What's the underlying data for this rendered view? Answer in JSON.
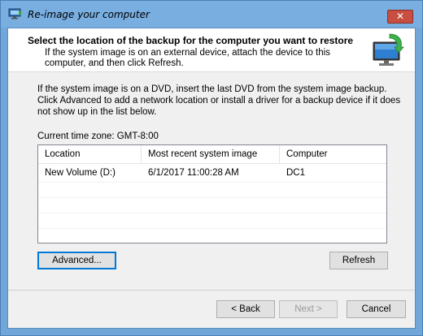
{
  "window": {
    "title": "Re-image your computer",
    "close_label": "✕"
  },
  "header": {
    "title": "Select the location of the backup for the computer you want to restore",
    "subtitle": "If the system image is on an external device, attach the device to this computer, and then click Refresh."
  },
  "body": {
    "instructions": "If the system image is on a DVD, insert the last DVD from the system image backup. Click Advanced to add a network location or install a driver for a backup device if it does not show up in the list below.",
    "timezone": "Current time zone: GMT-8:00"
  },
  "list": {
    "columns": [
      "Location",
      "Most recent system image",
      "Computer"
    ],
    "rows": [
      {
        "location": "New Volume (D:)",
        "image": "6/1/2017 11:00:28 AM",
        "computer": "DC1"
      }
    ]
  },
  "buttons": {
    "advanced": "Advanced...",
    "refresh": "Refresh",
    "back": "< Back",
    "next": "Next >",
    "cancel": "Cancel"
  },
  "icons": {
    "title": "computer-restore-icon",
    "header": "monitor-restore-icon"
  },
  "colors": {
    "titlebar": "#78aee0",
    "close": "#c74e41",
    "default_button_border": "#0078d7"
  }
}
